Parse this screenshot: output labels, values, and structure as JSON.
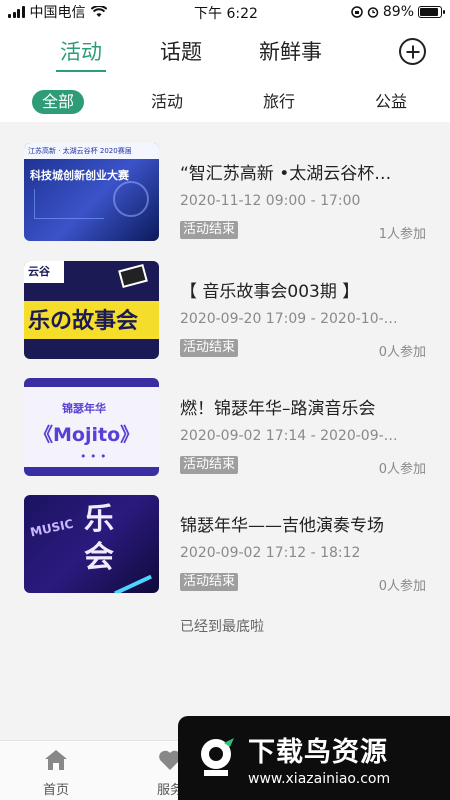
{
  "status_bar": {
    "carrier": "中国电信",
    "time": "下午 6:22",
    "battery_text": "89%",
    "battery_level": 0.89
  },
  "main_tabs": [
    {
      "label": "活动",
      "active": true
    },
    {
      "label": "话题",
      "active": false
    },
    {
      "label": "新鲜事",
      "active": false
    }
  ],
  "categories": [
    {
      "label": "全部",
      "active": true
    },
    {
      "label": "活动",
      "active": false
    },
    {
      "label": "旅行",
      "active": false
    },
    {
      "label": "公益",
      "active": false
    }
  ],
  "events": [
    {
      "title": "“智汇苏高新 •太湖云谷杯…",
      "time": "2020-11-12 09:00 - 17:00",
      "status": "活动结束",
      "participants": "1人参加",
      "thumb_text": "科技城创新创业大赛",
      "thumb_header": "江苏高新 · 太湖云谷杯 2020赛届"
    },
    {
      "title": "【 音乐故事会003期 】",
      "time": "2020-09-20 17:09 - 2020-10-1…",
      "status": "活动结束",
      "participants": "0人参加",
      "thumb_text": "乐の故事会",
      "thumb_header": "云谷"
    },
    {
      "title": "燃！锦瑟年华–路演音乐会",
      "time": "2020-09-02 17:14 - 2020-09-0…",
      "status": "活动结束",
      "participants": "0人参加",
      "thumb_text": "《Mojito》",
      "thumb_header": "锦瑟年华"
    },
    {
      "title": "锦瑟年华——吉他演奏专场",
      "time": "2020-09-02 17:12 - 18:12",
      "status": "活动结束",
      "participants": "0人参加",
      "thumb_text": "乐会",
      "thumb_header": "MUSIC"
    }
  ],
  "end_message": "已经到最底啦",
  "bottom_nav": [
    {
      "label": "首页",
      "icon": "home-icon"
    },
    {
      "label": "服务",
      "icon": "heart-icon"
    }
  ],
  "watermark": {
    "brand": "下载鸟资源",
    "url": "www.xiazainiao.com"
  },
  "colors": {
    "accent": "#2e9c77",
    "badge": "#9e9e9e",
    "list_bg": "#f3f3f3"
  }
}
